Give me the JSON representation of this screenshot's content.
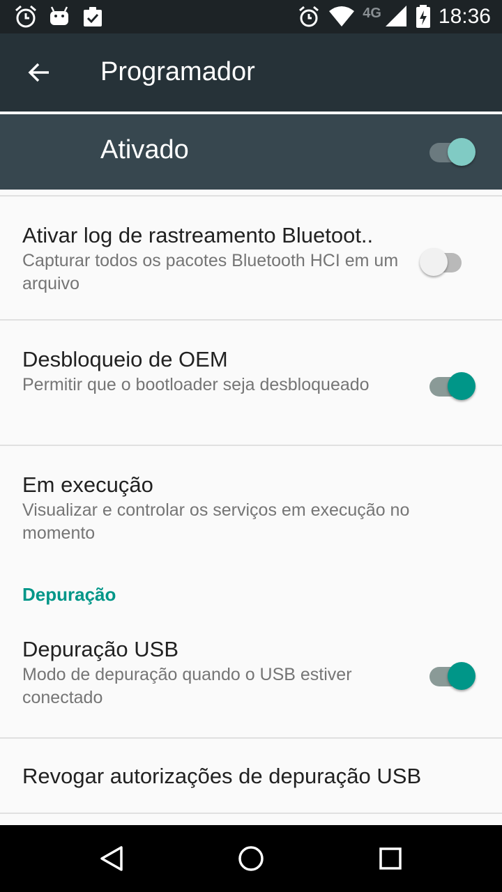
{
  "status_bar": {
    "left_icons": [
      "alarm-icon",
      "android-icon",
      "task-check-icon"
    ],
    "right_icons": [
      "alarm-icon",
      "wifi-icon",
      "signal-icon",
      "battery-charging-icon"
    ],
    "network_type": "4G",
    "time": "18:36"
  },
  "app_bar": {
    "back_icon": "arrow-back-icon",
    "title": "Programador",
    "background": "#263238"
  },
  "master_switch": {
    "label": "Ativado",
    "checked": true,
    "background": "#37474f"
  },
  "items": [
    {
      "title": "Ativar log de rastreamento Bluetoot..",
      "subtitle": "Capturar todos os pacotes Bluetooth HCI em um arquivo",
      "has_switch": true,
      "checked": false
    },
    {
      "title": "Desbloqueio de OEM",
      "subtitle": "Permitir que o bootloader seja desbloqueado",
      "has_switch": true,
      "checked": true
    },
    {
      "title": "Em execução",
      "subtitle": "Visualizar e controlar os serviços em execução no momento",
      "has_switch": false
    }
  ],
  "category": {
    "label": "Depuração",
    "color": "#009688"
  },
  "debug_items": [
    {
      "title": "Depuração USB",
      "subtitle": "Modo de depuração quando o USB estiver conectado",
      "has_switch": true,
      "checked": true
    },
    {
      "title": "Revogar autorizações de depuração USB",
      "has_switch": false
    }
  ],
  "nav_bar": {
    "buttons": [
      "back-triangle-icon",
      "home-circle-icon",
      "recents-square-icon"
    ]
  },
  "colors": {
    "accent": "#009688",
    "text_primary": "#212121",
    "text_secondary": "#757575"
  }
}
